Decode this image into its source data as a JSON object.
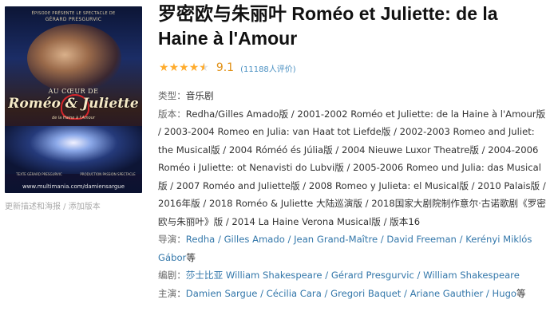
{
  "poster": {
    "producer_line1": "ÉPISODE PRÉSENTE LE SPECTACLE DE",
    "producer_line2": "GÉRARD PRESGURVIC",
    "crown": "AU CŒUR DE",
    "logo": "Roméo & Juliette",
    "sub": "de la Haine à l'Amour",
    "credit_left": "TEXTE GÉRARD PRESGURVIC",
    "credit_right": "PRODUCTION PASSION SPECTACLE",
    "site": "www.multimania.com/damiensargue"
  },
  "poster_links": {
    "update": "更新描述和海报",
    "separator": " / ",
    "add_version": "添加版本"
  },
  "title": "罗密欧与朱丽叶 Roméo et Juliette: de la Haine à l'Amour",
  "rating": {
    "score": "9.1",
    "count_text": "(11188人评价)",
    "stars_value": 4.5,
    "star_color": "#ffac2d"
  },
  "info": {
    "type_label": "类型：",
    "type_value": "音乐剧",
    "version_label": "版本：",
    "version_text": "Redha/Gilles Amado版 / 2001-2002 Roméo et Juliette: de la Haine à l'Amour版 / 2003-2004 Romeo en Julia: van Haat tot Liefde版 / 2002-2003 Romeo and Juliet: the Musical版 / 2004 Róméó és Júlia版 / 2004 Nieuwe Luxor Theatre版 / 2004-2006 Roméo i Juliette: ot Nenavisti do Lubvi版 / 2005-2006 Romeo und Julia: das Musical版 / 2007 Roméo and Juliette版 / 2008 Romeo y Julieta: el Musical版 / 2010 Palais版 / 2016年版 / 2018 Roméo & Juliette 大陆巡演版 / 2018国家大剧院制作意尔·古诺歌剧《罗密欧与朱丽叶》版 / 2014 La Haine Verona Musical版 / 版本16",
    "director_label": "导演：",
    "directors": [
      "Redha",
      "Gilles Amado",
      "Jean Grand-Maître",
      "David Freeman",
      "Kerényi Miklós Gábor"
    ],
    "director_suffix": "等",
    "writer_label": "编剧：",
    "writers": [
      "莎士比亚 William Shakespeare",
      "Gérard Presgurvic",
      "William Shakespeare"
    ],
    "cast_label": "主演：",
    "cast": [
      "Damien Sargue",
      "Cécilia Cara",
      "Gregori Baquet",
      "Ariane Gauthier",
      "Hugo"
    ],
    "cast_suffix": "等",
    "separator": " / "
  }
}
